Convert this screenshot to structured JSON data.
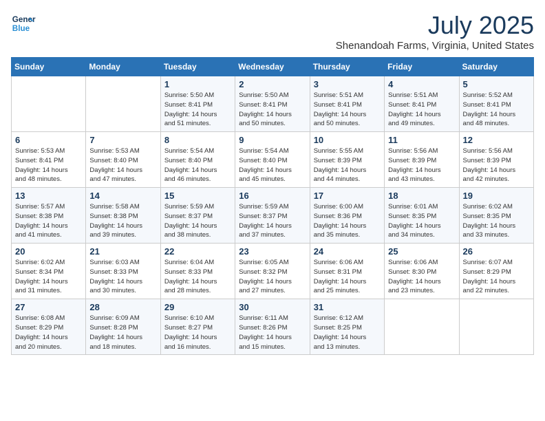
{
  "header": {
    "logo_line1": "General",
    "logo_line2": "Blue",
    "month_year": "July 2025",
    "location": "Shenandoah Farms, Virginia, United States"
  },
  "days_of_week": [
    "Sunday",
    "Monday",
    "Tuesday",
    "Wednesday",
    "Thursday",
    "Friday",
    "Saturday"
  ],
  "weeks": [
    [
      {
        "day": "",
        "info": ""
      },
      {
        "day": "",
        "info": ""
      },
      {
        "day": "1",
        "info": "Sunrise: 5:50 AM\nSunset: 8:41 PM\nDaylight: 14 hours\nand 51 minutes."
      },
      {
        "day": "2",
        "info": "Sunrise: 5:50 AM\nSunset: 8:41 PM\nDaylight: 14 hours\nand 50 minutes."
      },
      {
        "day": "3",
        "info": "Sunrise: 5:51 AM\nSunset: 8:41 PM\nDaylight: 14 hours\nand 50 minutes."
      },
      {
        "day": "4",
        "info": "Sunrise: 5:51 AM\nSunset: 8:41 PM\nDaylight: 14 hours\nand 49 minutes."
      },
      {
        "day": "5",
        "info": "Sunrise: 5:52 AM\nSunset: 8:41 PM\nDaylight: 14 hours\nand 48 minutes."
      }
    ],
    [
      {
        "day": "6",
        "info": "Sunrise: 5:53 AM\nSunset: 8:41 PM\nDaylight: 14 hours\nand 48 minutes."
      },
      {
        "day": "7",
        "info": "Sunrise: 5:53 AM\nSunset: 8:40 PM\nDaylight: 14 hours\nand 47 minutes."
      },
      {
        "day": "8",
        "info": "Sunrise: 5:54 AM\nSunset: 8:40 PM\nDaylight: 14 hours\nand 46 minutes."
      },
      {
        "day": "9",
        "info": "Sunrise: 5:54 AM\nSunset: 8:40 PM\nDaylight: 14 hours\nand 45 minutes."
      },
      {
        "day": "10",
        "info": "Sunrise: 5:55 AM\nSunset: 8:39 PM\nDaylight: 14 hours\nand 44 minutes."
      },
      {
        "day": "11",
        "info": "Sunrise: 5:56 AM\nSunset: 8:39 PM\nDaylight: 14 hours\nand 43 minutes."
      },
      {
        "day": "12",
        "info": "Sunrise: 5:56 AM\nSunset: 8:39 PM\nDaylight: 14 hours\nand 42 minutes."
      }
    ],
    [
      {
        "day": "13",
        "info": "Sunrise: 5:57 AM\nSunset: 8:38 PM\nDaylight: 14 hours\nand 41 minutes."
      },
      {
        "day": "14",
        "info": "Sunrise: 5:58 AM\nSunset: 8:38 PM\nDaylight: 14 hours\nand 39 minutes."
      },
      {
        "day": "15",
        "info": "Sunrise: 5:59 AM\nSunset: 8:37 PM\nDaylight: 14 hours\nand 38 minutes."
      },
      {
        "day": "16",
        "info": "Sunrise: 5:59 AM\nSunset: 8:37 PM\nDaylight: 14 hours\nand 37 minutes."
      },
      {
        "day": "17",
        "info": "Sunrise: 6:00 AM\nSunset: 8:36 PM\nDaylight: 14 hours\nand 35 minutes."
      },
      {
        "day": "18",
        "info": "Sunrise: 6:01 AM\nSunset: 8:35 PM\nDaylight: 14 hours\nand 34 minutes."
      },
      {
        "day": "19",
        "info": "Sunrise: 6:02 AM\nSunset: 8:35 PM\nDaylight: 14 hours\nand 33 minutes."
      }
    ],
    [
      {
        "day": "20",
        "info": "Sunrise: 6:02 AM\nSunset: 8:34 PM\nDaylight: 14 hours\nand 31 minutes."
      },
      {
        "day": "21",
        "info": "Sunrise: 6:03 AM\nSunset: 8:33 PM\nDaylight: 14 hours\nand 30 minutes."
      },
      {
        "day": "22",
        "info": "Sunrise: 6:04 AM\nSunset: 8:33 PM\nDaylight: 14 hours\nand 28 minutes."
      },
      {
        "day": "23",
        "info": "Sunrise: 6:05 AM\nSunset: 8:32 PM\nDaylight: 14 hours\nand 27 minutes."
      },
      {
        "day": "24",
        "info": "Sunrise: 6:06 AM\nSunset: 8:31 PM\nDaylight: 14 hours\nand 25 minutes."
      },
      {
        "day": "25",
        "info": "Sunrise: 6:06 AM\nSunset: 8:30 PM\nDaylight: 14 hours\nand 23 minutes."
      },
      {
        "day": "26",
        "info": "Sunrise: 6:07 AM\nSunset: 8:29 PM\nDaylight: 14 hours\nand 22 minutes."
      }
    ],
    [
      {
        "day": "27",
        "info": "Sunrise: 6:08 AM\nSunset: 8:29 PM\nDaylight: 14 hours\nand 20 minutes."
      },
      {
        "day": "28",
        "info": "Sunrise: 6:09 AM\nSunset: 8:28 PM\nDaylight: 14 hours\nand 18 minutes."
      },
      {
        "day": "29",
        "info": "Sunrise: 6:10 AM\nSunset: 8:27 PM\nDaylight: 14 hours\nand 16 minutes."
      },
      {
        "day": "30",
        "info": "Sunrise: 6:11 AM\nSunset: 8:26 PM\nDaylight: 14 hours\nand 15 minutes."
      },
      {
        "day": "31",
        "info": "Sunrise: 6:12 AM\nSunset: 8:25 PM\nDaylight: 14 hours\nand 13 minutes."
      },
      {
        "day": "",
        "info": ""
      },
      {
        "day": "",
        "info": ""
      }
    ]
  ]
}
